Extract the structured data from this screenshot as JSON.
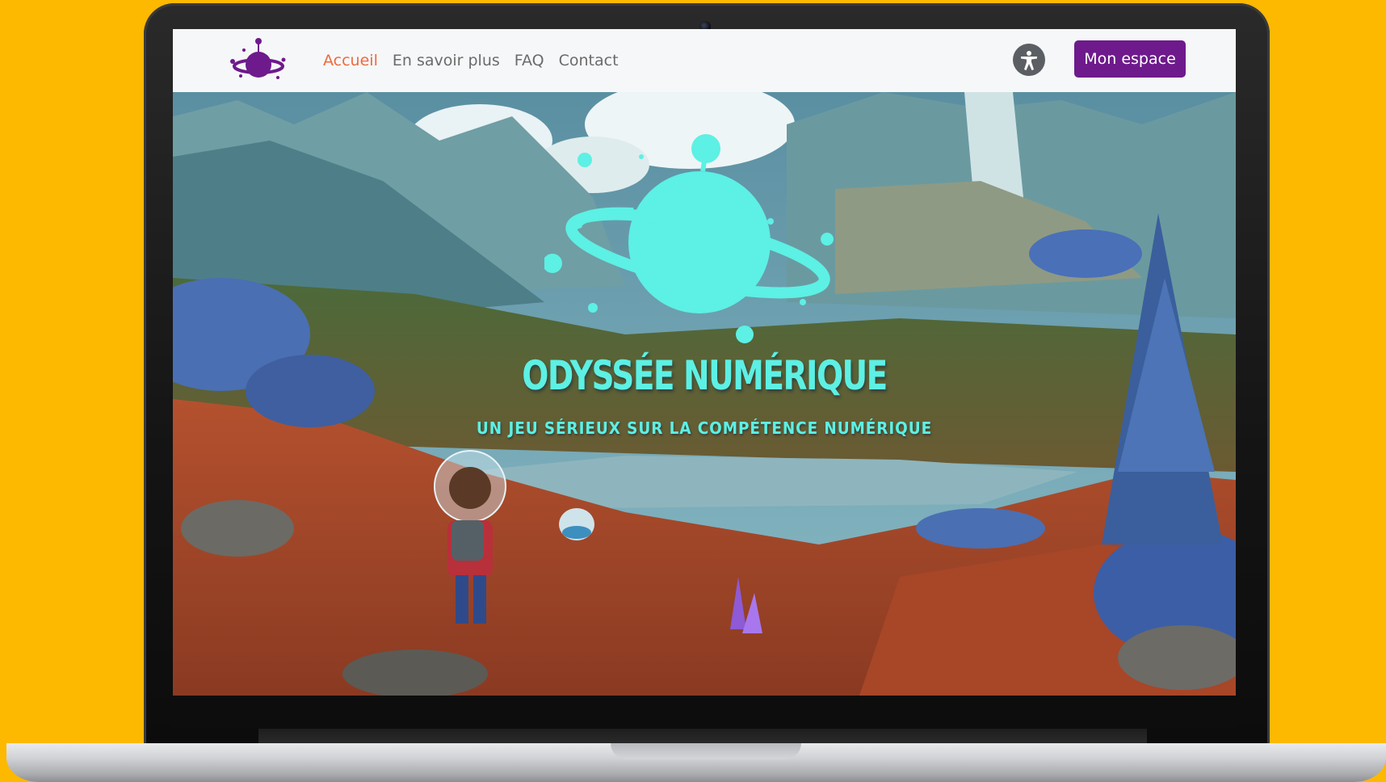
{
  "nav": {
    "links": [
      {
        "label": "Accueil",
        "active": true
      },
      {
        "label": "En savoir plus",
        "active": false
      },
      {
        "label": "FAQ",
        "active": false
      },
      {
        "label": "Contact",
        "active": false
      }
    ],
    "account_button": "Mon espace",
    "accessibility_icon": "accessibility-icon",
    "logo_icon": "planet-logo-icon"
  },
  "hero": {
    "title": "ODYSSÉE NUMÉRIQUE",
    "subtitle": "UN JEU SÉRIEUX SUR LA COMPÉTENCE NUMÉRIQUE",
    "emblem_icon": "planet-emblem-icon"
  },
  "colors": {
    "background": "#FDB800",
    "accent_active": "#EE6A3C",
    "button": "#6E1A8C",
    "hero_text": "#5DF0E4"
  }
}
